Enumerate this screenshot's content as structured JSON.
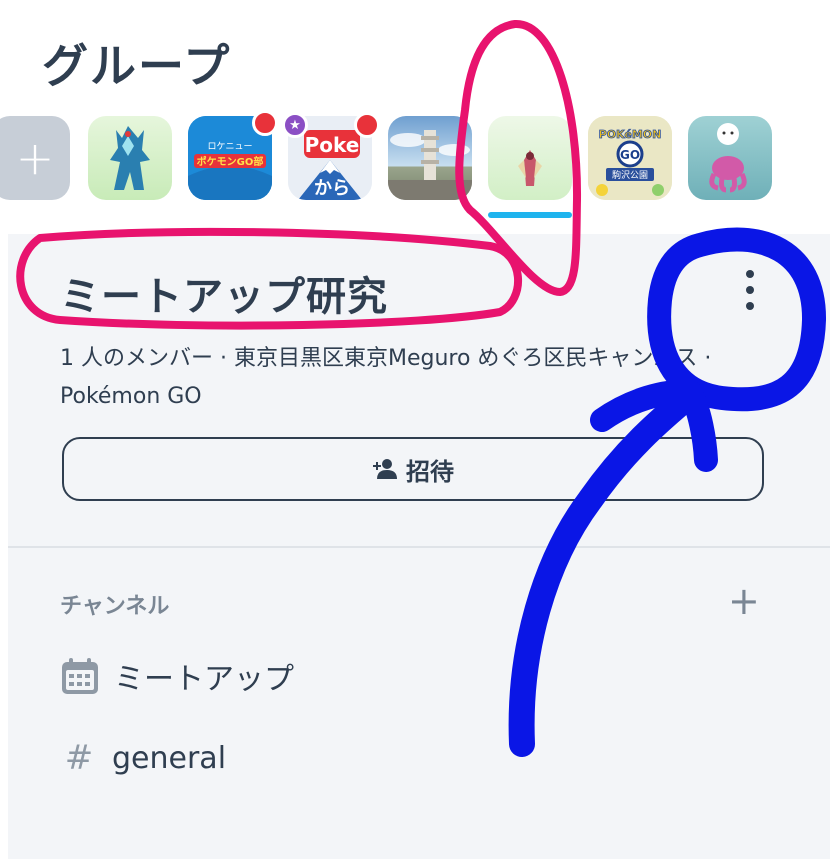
{
  "header": {
    "title": "グループ"
  },
  "group_strip": {
    "add_label": "+",
    "tiles": [
      {
        "name": "dark-monster",
        "icon": "dark-monster-avatar",
        "bg": "#d9f1cf"
      },
      {
        "name": "pokemon-go-club",
        "icon": "pokemon-go-club-logo",
        "text_top": "ロケニュー",
        "text_main": "ポケモンGO部",
        "bg": "#1c8ad8"
      },
      {
        "name": "poke-kara",
        "icon": "poke-kara-logo",
        "text_top": "Poke",
        "text_bottom": "から",
        "bg": "#e9eef5"
      },
      {
        "name": "tower-photo",
        "icon": "tower-photo",
        "bg": "#7fa7cf"
      },
      {
        "name": "selected-group",
        "icon": "monster-avatar",
        "bg": "#dff3d6"
      },
      {
        "name": "komazawa-park",
        "icon": "pokemon-go-logo",
        "text_top": "POKéMON",
        "text_mid": "GO",
        "text_bottom": "駒沢公園",
        "bg": "#eae7c5"
      },
      {
        "name": "pink-monster",
        "icon": "pink-monster-avatar",
        "bg": "#8cc8cf"
      }
    ]
  },
  "group": {
    "name": "ミートアップ研究",
    "description": "1 人のメンバー · 東京目黒区東京Meguro めぐろ区民キャンパス · Pokémon GO",
    "invite_label": "招待"
  },
  "channels": {
    "header": "チャンネル",
    "add_label": "+",
    "items": [
      {
        "label": "ミートアップ",
        "icon": "calendar-icon"
      },
      {
        "label": "general",
        "icon": "hash-icon",
        "glyph": "#"
      }
    ]
  },
  "colors": {
    "accent": "#1fb4ee",
    "text": "#2f3e50",
    "muted": "#7a8694",
    "panel": "#f3f5f8",
    "annotation_pink": "#e8136e",
    "annotation_blue": "#0a16e6"
  }
}
